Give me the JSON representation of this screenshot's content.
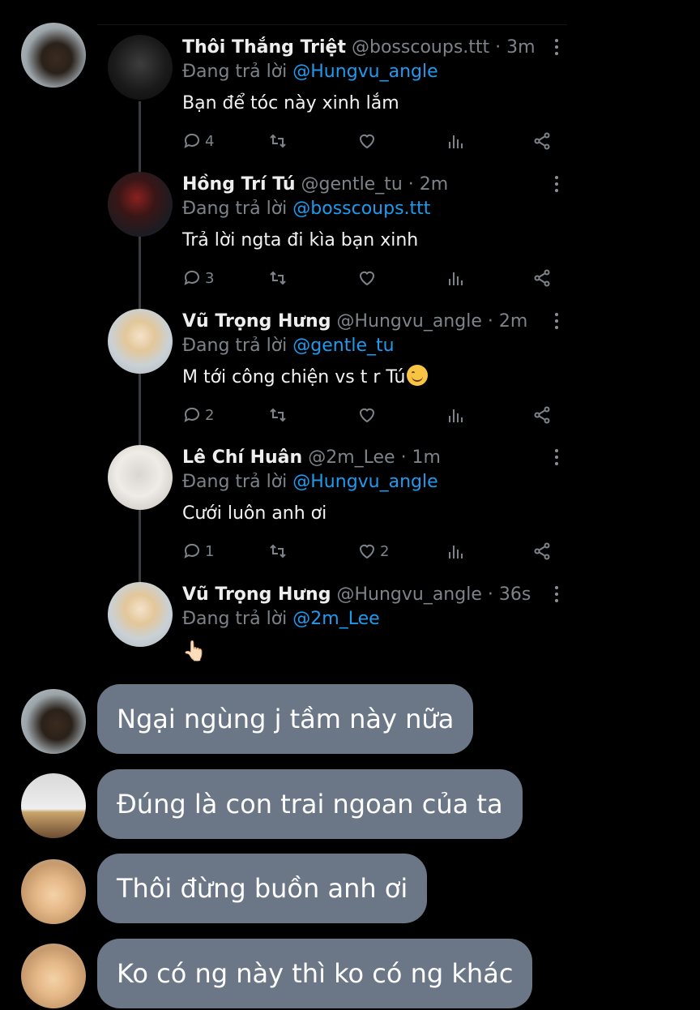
{
  "tweets": [
    {
      "name": "Thôi Thắng Triệt",
      "handle": "@bosscoups.ttt · 3m",
      "reply_prefix": "Đang trả lời",
      "mention": "@Hungvu_angle",
      "text": "Bạn để tóc này xinh lắm",
      "reply_count": "4",
      "like_count": ""
    },
    {
      "name": "Hồng Trí Tú",
      "handle": "@gentle_tu · 2m",
      "reply_prefix": "Đang trả lời",
      "mention": "@bosscoups.ttt",
      "text": "Trả lời ngta đi kìa bạn xinh",
      "reply_count": "3",
      "like_count": ""
    },
    {
      "name": "Vũ Trọng Hưng",
      "handle": "@Hungvu_angle · 2m",
      "reply_prefix": "Đang trả lời",
      "mention": "@gentle_tu",
      "text": "M tới công chiện vs t r Tú",
      "reply_count": "2",
      "like_count": ""
    },
    {
      "name": "Lê Chí Huân",
      "handle": "@2m_Lee · 1m",
      "reply_prefix": "Đang trả lời",
      "mention": "@Hungvu_angle",
      "text": "Cưới luôn anh ơi",
      "reply_count": "1",
      "like_count": "2"
    },
    {
      "name": "Vũ Trọng Hưng",
      "handle": "@Hungvu_angle · 36s",
      "reply_prefix": "Đang trả lời",
      "mention": "@2m_Lee",
      "text": "👆🏻"
    }
  ],
  "comments": [
    {
      "text": "Ngại ngùng j tầm này nữa"
    },
    {
      "text": "Đúng là con trai ngoan của ta"
    },
    {
      "text": "Thôi đừng buồn anh ơi"
    },
    {
      "text": "Ko có ng này thì ko có ng khác"
    }
  ],
  "colors": {
    "background": "#000000",
    "mention": "#1d9bf0",
    "secondary_text": "#7d8389",
    "bubble": "#6b7786"
  },
  "icons": [
    "reply-icon",
    "retweet-icon",
    "like-icon",
    "views-icon",
    "share-icon",
    "more-icon"
  ]
}
